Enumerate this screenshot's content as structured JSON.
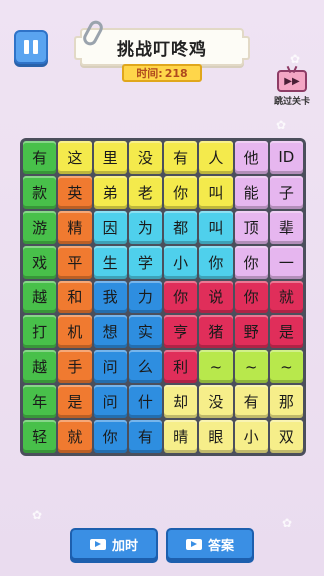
{
  "header": {
    "title": "挑战叮咚鸡",
    "timer_label": "时间:",
    "timer_value": "218",
    "skip_label": "跳过关卡",
    "skip_icon": "tv-fast-forward-icon"
  },
  "board": {
    "rows": [
      [
        {
          "t": "有",
          "c": "green"
        },
        {
          "t": "这",
          "c": "yellow"
        },
        {
          "t": "里",
          "c": "yellow"
        },
        {
          "t": "没",
          "c": "yellow"
        },
        {
          "t": "有",
          "c": "yellow"
        },
        {
          "t": "人",
          "c": "yellow"
        },
        {
          "t": "他",
          "c": "lilac"
        },
        {
          "t": "ID",
          "c": "lilac"
        }
      ],
      [
        {
          "t": "款",
          "c": "green"
        },
        {
          "t": "英",
          "c": "orange"
        },
        {
          "t": "弟",
          "c": "yellow"
        },
        {
          "t": "老",
          "c": "yellow"
        },
        {
          "t": "你",
          "c": "yellow"
        },
        {
          "t": "叫",
          "c": "yellow"
        },
        {
          "t": "能",
          "c": "lilac"
        },
        {
          "t": "子",
          "c": "lilac"
        }
      ],
      [
        {
          "t": "游",
          "c": "green"
        },
        {
          "t": "精",
          "c": "orange"
        },
        {
          "t": "因",
          "c": "cyan"
        },
        {
          "t": "为",
          "c": "cyan"
        },
        {
          "t": "都",
          "c": "cyan"
        },
        {
          "t": "叫",
          "c": "cyan"
        },
        {
          "t": "顶",
          "c": "lilac"
        },
        {
          "t": "辈",
          "c": "lilac"
        }
      ],
      [
        {
          "t": "戏",
          "c": "green"
        },
        {
          "t": "平",
          "c": "orange"
        },
        {
          "t": "生",
          "c": "cyan"
        },
        {
          "t": "学",
          "c": "cyan"
        },
        {
          "t": "小",
          "c": "cyan"
        },
        {
          "t": "你",
          "c": "cyan"
        },
        {
          "t": "你",
          "c": "lilac"
        },
        {
          "t": "一",
          "c": "lilac"
        }
      ],
      [
        {
          "t": "越",
          "c": "green"
        },
        {
          "t": "和",
          "c": "orange"
        },
        {
          "t": "我",
          "c": "blue"
        },
        {
          "t": "力",
          "c": "blue"
        },
        {
          "t": "你",
          "c": "red"
        },
        {
          "t": "说",
          "c": "red"
        },
        {
          "t": "你",
          "c": "red"
        },
        {
          "t": "就",
          "c": "red"
        }
      ],
      [
        {
          "t": "打",
          "c": "green"
        },
        {
          "t": "机",
          "c": "orange"
        },
        {
          "t": "想",
          "c": "blue"
        },
        {
          "t": "实",
          "c": "blue"
        },
        {
          "t": "亨",
          "c": "red"
        },
        {
          "t": "猪",
          "c": "red"
        },
        {
          "t": "野",
          "c": "red"
        },
        {
          "t": "是",
          "c": "red"
        }
      ],
      [
        {
          "t": "越",
          "c": "green"
        },
        {
          "t": "手",
          "c": "orange"
        },
        {
          "t": "问",
          "c": "blue"
        },
        {
          "t": "么",
          "c": "blue"
        },
        {
          "t": "利",
          "c": "red"
        },
        {
          "t": "~",
          "c": "lime"
        },
        {
          "t": "~",
          "c": "lime"
        },
        {
          "t": "~",
          "c": "lime"
        }
      ],
      [
        {
          "t": "年",
          "c": "green"
        },
        {
          "t": "是",
          "c": "orange"
        },
        {
          "t": "问",
          "c": "blue"
        },
        {
          "t": "什",
          "c": "blue"
        },
        {
          "t": "却",
          "c": "pyellow"
        },
        {
          "t": "没",
          "c": "pyellow"
        },
        {
          "t": "有",
          "c": "pyellow"
        },
        {
          "t": "那",
          "c": "pyellow"
        }
      ],
      [
        {
          "t": "轻",
          "c": "green"
        },
        {
          "t": "就",
          "c": "orange"
        },
        {
          "t": "你",
          "c": "blue"
        },
        {
          "t": "有",
          "c": "blue"
        },
        {
          "t": "晴",
          "c": "pyellow"
        },
        {
          "t": "眼",
          "c": "pyellow"
        },
        {
          "t": "小",
          "c": "pyellow"
        },
        {
          "t": "双",
          "c": "pyellow"
        }
      ]
    ]
  },
  "footer": {
    "add_time_label": "加时",
    "answer_label": "答案",
    "video_icon": "video-icon"
  },
  "colors": {
    "green": "#48c04a",
    "yellow": "#f4ea4c",
    "lilac": "#e6b6ef",
    "orange": "#f07a30",
    "cyan": "#4fd0ec",
    "blue": "#2e8ee0",
    "red": "#e02e5a",
    "lime": "#b8e84c",
    "pyellow": "#f6ee8a"
  }
}
